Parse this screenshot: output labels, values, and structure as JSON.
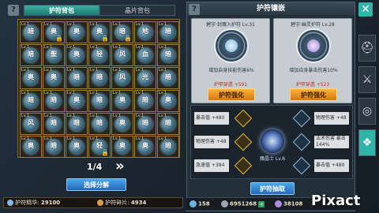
{
  "left": {
    "tabs": [
      {
        "label": "护符背包"
      },
      {
        "label": "晶片背包"
      }
    ],
    "pager": "1/4",
    "decompose_button": "选择分解",
    "cells": [
      {
        "lv": "Lv.1",
        "ch": "暗",
        "c": "blue",
        "lock": false
      },
      {
        "lv": "Lv.1",
        "ch": "奥",
        "c": "blue",
        "lock": true
      },
      {
        "lv": "Lv.1",
        "ch": "奥",
        "c": "blue",
        "lock": false
      },
      {
        "lv": "Lv.1",
        "ch": "奥",
        "c": "blue",
        "lock": true
      },
      {
        "lv": "Lv.1",
        "ch": "暗",
        "c": "blue",
        "lock": true
      },
      {
        "lv": "Lv.1",
        "ch": "地",
        "c": "blue",
        "lock": false
      },
      {
        "lv": "Lv.1",
        "ch": "暗",
        "c": "blue",
        "lock": false
      },
      {
        "lv": "Lv.1",
        "ch": "暗",
        "c": "blue",
        "lock": false
      },
      {
        "lv": "Lv.1",
        "ch": "聖",
        "c": "blue",
        "lock": false
      },
      {
        "lv": "Lv.1",
        "ch": "奥",
        "c": "blue",
        "lock": false
      },
      {
        "lv": "Lv.1",
        "ch": "轻",
        "c": "blue",
        "lock": false
      },
      {
        "lv": "Lv.1",
        "ch": "风",
        "c": "blue",
        "lock": false
      },
      {
        "lv": "Lv.1",
        "ch": "血",
        "c": "blue",
        "lock": false
      },
      {
        "lv": "Lv.1",
        "ch": "暗",
        "c": "blue",
        "lock": false
      },
      {
        "lv": "Lv.1",
        "ch": "奥",
        "c": "blue",
        "lock": false
      },
      {
        "lv": "Lv.1",
        "ch": "奥",
        "c": "blue",
        "lock": false
      },
      {
        "lv": "Lv.1",
        "ch": "暗",
        "c": "blue",
        "lock": false
      },
      {
        "lv": "Lv.1",
        "ch": "暗",
        "c": "blue",
        "lock": false
      },
      {
        "lv": "Lv.1",
        "ch": "风",
        "c": "blue",
        "lock": false
      },
      {
        "lv": "Lv.1",
        "ch": "光",
        "c": "blue",
        "lock": false
      },
      {
        "lv": "Lv.1",
        "ch": "暗",
        "c": "blue",
        "lock": false
      },
      {
        "lv": "Lv.1",
        "ch": "暗",
        "c": "blue",
        "lock": false
      },
      {
        "lv": "Lv.1",
        "ch": "暗",
        "c": "blue",
        "lock": false
      },
      {
        "lv": "Lv.1",
        "ch": "奥",
        "c": "blue",
        "lock": false
      },
      {
        "lv": "Lv.1",
        "ch": "暗",
        "c": "blue",
        "lock": false
      },
      {
        "lv": "Lv.1",
        "ch": "奥",
        "c": "blue",
        "lock": false
      },
      {
        "lv": "Lv.1",
        "ch": "暗",
        "c": "blue",
        "lock": false
      },
      {
        "lv": "Lv.1",
        "ch": "奥",
        "c": "blue",
        "lock": false
      },
      {
        "lv": "Lv.1",
        "ch": "风",
        "c": "blue",
        "lock": false
      },
      {
        "lv": "Lv.1",
        "ch": "暗",
        "c": "blue",
        "lock": false
      },
      {
        "lv": "Lv.1",
        "ch": "暗",
        "c": "blue",
        "lock": false
      },
      {
        "lv": "Lv.1",
        "ch": "暗",
        "c": "blue",
        "lock": false
      },
      {
        "lv": "Lv.1",
        "ch": "奥",
        "c": "blue",
        "lock": false
      },
      {
        "lv": "Lv.1",
        "ch": "暗",
        "c": "blue",
        "lock": false
      },
      {
        "lv": "Lv.1",
        "ch": "暗",
        "c": "blue",
        "lock": false
      },
      {
        "lv": "Lv.1",
        "ch": "奥",
        "c": "blue",
        "lock": false
      },
      {
        "lv": "Lv.1",
        "ch": "暗",
        "c": "blue",
        "lock": false
      },
      {
        "lv": "Lv.1",
        "ch": "奥",
        "c": "blue",
        "lock": false
      },
      {
        "lv": "Lv.1",
        "ch": "轻",
        "c": "blue",
        "lock": true
      },
      {
        "lv": "Lv.1",
        "ch": "奥",
        "c": "blue",
        "lock": false
      },
      {
        "lv": "Lv.1",
        "ch": "奥",
        "c": "blue",
        "lock": false
      },
      {
        "lv": "Lv.1",
        "ch": "暗",
        "c": "blue",
        "lock": false
      }
    ]
  },
  "left_bottom": {
    "gold_label": "护符精华:",
    "gold_value": "29100",
    "shard_label": "护符碎片:",
    "shard_value": "4934"
  },
  "right": {
    "title": "护符镶嵌",
    "slot_left": {
      "name": "碧宇·封魔入护符 Lv.31",
      "desc": "增加自身技能伤害6%",
      "stat": "护甲穿透 +591",
      "button": "护符强化"
    },
    "slot_right": {
      "name": "碧宇·幽灵护符 Lv.28",
      "desc": "增加自身暴击伤害10%",
      "stat": "护甲穿透 +523",
      "button": "护符强化"
    },
    "attrs_left": [
      {
        "label": "暴击值 +480"
      },
      {
        "label": "物理伤害 +48"
      },
      {
        "label": "急速值 +384"
      }
    ],
    "attrs_right": [
      {
        "label": "物理伤害 +48"
      },
      {
        "label": "法术伤害 暴击 144%"
      },
      {
        "label": "暴击值 +480"
      }
    ],
    "center_label": "魔晶士 Lv.6",
    "unlock_button": "护符抽取"
  },
  "resources": {
    "stamina": "158",
    "gold": "6951268",
    "diamond": "38108"
  },
  "watermark": "Pixact",
  "colors": {
    "accent": "#2fb5a8",
    "frame": "#a17a33",
    "button_blue": "#3a8ad8",
    "button_gold": "#f0a020"
  }
}
